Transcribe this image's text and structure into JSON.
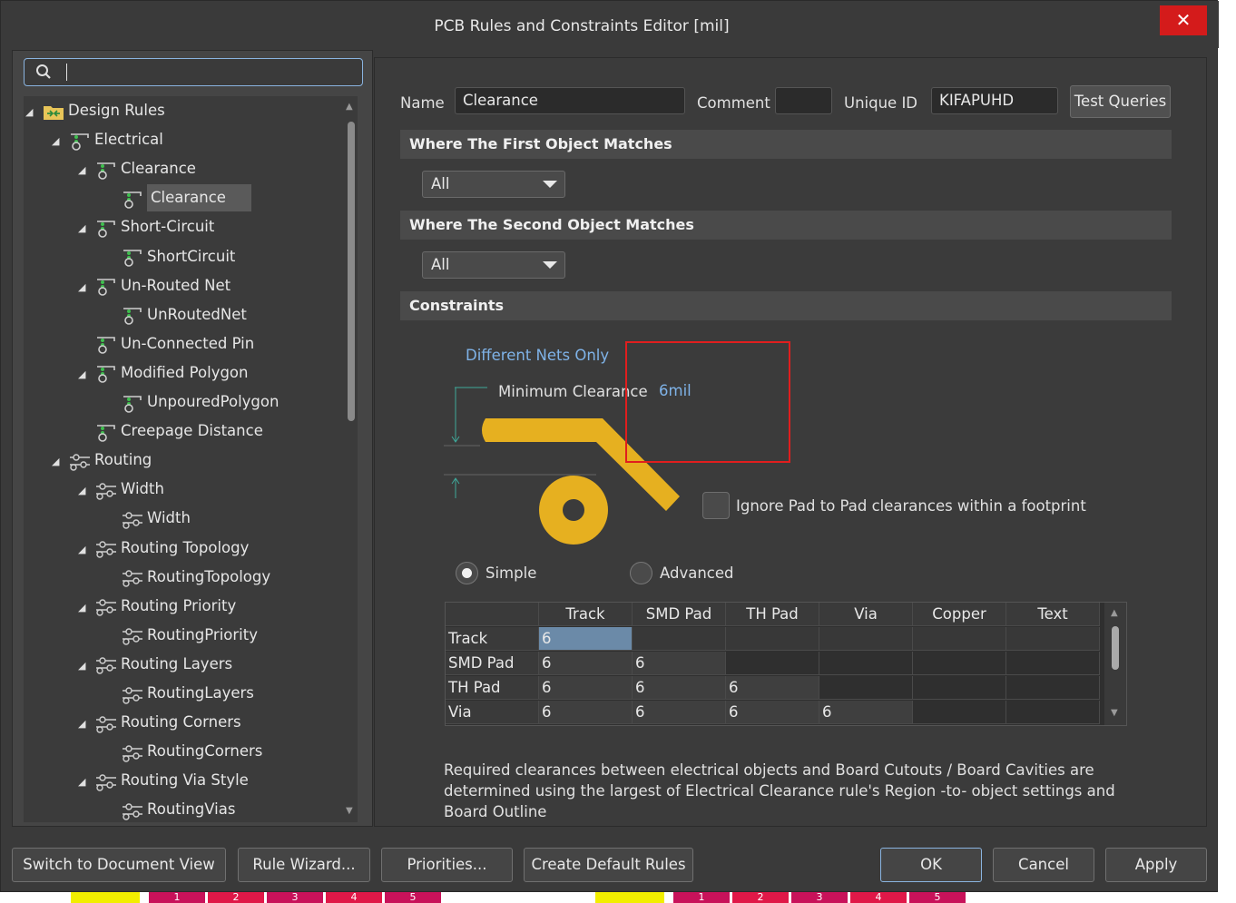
{
  "window": {
    "title": "PCB Rules and Constraints Editor [mil]",
    "close_glyph": "✕"
  },
  "search": {
    "value": "",
    "placeholder": ""
  },
  "tree": [
    {
      "label": "Design Rules",
      "level": 0,
      "expanded": true,
      "icon": "folder-rules-icon"
    },
    {
      "label": "Electrical",
      "level": 1,
      "expanded": true,
      "icon": "electrical-rule-icon"
    },
    {
      "label": "Clearance",
      "level": 2,
      "expanded": true,
      "icon": "electrical-rule-icon"
    },
    {
      "label": "Clearance",
      "level": 3,
      "selected": true,
      "icon": "electrical-rule-icon"
    },
    {
      "label": "Short-Circuit",
      "level": 2,
      "expanded": true,
      "icon": "electrical-rule-icon"
    },
    {
      "label": "ShortCircuit",
      "level": 3,
      "icon": "electrical-rule-icon"
    },
    {
      "label": "Un-Routed Net",
      "level": 2,
      "expanded": true,
      "icon": "electrical-rule-icon"
    },
    {
      "label": "UnRoutedNet",
      "level": 3,
      "icon": "electrical-rule-icon"
    },
    {
      "label": "Un-Connected Pin",
      "level": 2,
      "icon": "electrical-rule-icon"
    },
    {
      "label": "Modified Polygon",
      "level": 2,
      "expanded": true,
      "icon": "electrical-rule-icon"
    },
    {
      "label": "UnpouredPolygon",
      "level": 3,
      "icon": "electrical-rule-icon"
    },
    {
      "label": "Creepage Distance",
      "level": 2,
      "icon": "electrical-rule-icon"
    },
    {
      "label": "Routing",
      "level": 1,
      "expanded": true,
      "icon": "routing-rule-icon"
    },
    {
      "label": "Width",
      "level": 2,
      "expanded": true,
      "icon": "routing-rule-icon"
    },
    {
      "label": "Width",
      "level": 3,
      "icon": "routing-rule-icon"
    },
    {
      "label": "Routing Topology",
      "level": 2,
      "expanded": true,
      "icon": "routing-rule-icon"
    },
    {
      "label": "RoutingTopology",
      "level": 3,
      "icon": "routing-rule-icon"
    },
    {
      "label": "Routing Priority",
      "level": 2,
      "expanded": true,
      "icon": "routing-rule-icon"
    },
    {
      "label": "RoutingPriority",
      "level": 3,
      "icon": "routing-rule-icon"
    },
    {
      "label": "Routing Layers",
      "level": 2,
      "expanded": true,
      "icon": "routing-rule-icon"
    },
    {
      "label": "RoutingLayers",
      "level": 3,
      "icon": "routing-rule-icon"
    },
    {
      "label": "Routing Corners",
      "level": 2,
      "expanded": true,
      "icon": "routing-rule-icon"
    },
    {
      "label": "RoutingCorners",
      "level": 3,
      "icon": "routing-rule-icon"
    },
    {
      "label": "Routing Via Style",
      "level": 2,
      "expanded": true,
      "icon": "routing-rule-icon"
    },
    {
      "label": "RoutingVias",
      "level": 3,
      "icon": "routing-rule-icon"
    }
  ],
  "rule": {
    "name_label": "Name",
    "name_value": "Clearance",
    "comment_label": "Comment",
    "comment_value": "",
    "uid_label": "Unique ID",
    "uid_value": "KIFAPUHD",
    "test_queries": "Test Queries"
  },
  "first_match": {
    "header": "Where The First Object Matches",
    "selected": "All"
  },
  "second_match": {
    "header": "Where The Second Object Matches",
    "selected": "All"
  },
  "constraints": {
    "header": "Constraints",
    "net_scope": "Different Nets Only",
    "min_clearance_label": "Minimum Clearance",
    "min_clearance_value": "6mil",
    "ignore_pad_label": "Ignore Pad to Pad clearances within a footprint",
    "ignore_pad_checked": false,
    "mode_simple": "Simple",
    "mode_advanced": "Advanced",
    "mode_selected": "Simple",
    "pad_color": "#e6b020",
    "highlight_color": "#e01e1e"
  },
  "grid": {
    "columns": [
      "",
      "Track",
      "SMD Pad",
      "TH Pad",
      "Via",
      "Copper",
      "Text"
    ],
    "rows": [
      [
        "Track",
        "6",
        "",
        "",
        "",
        "",
        ""
      ],
      [
        "SMD Pad",
        "6",
        "6",
        "",
        "",
        "",
        ""
      ],
      [
        "TH Pad",
        "6",
        "6",
        "6",
        "",
        "",
        ""
      ],
      [
        "Via",
        "6",
        "6",
        "6",
        "6",
        "",
        ""
      ]
    ]
  },
  "footer_note": "Required clearances between electrical objects and Board Cutouts / Board Cavities are determined using the largest of Electrical Clearance rule's Region -to- object settings and Board Outline",
  "buttons": {
    "switch_view": "Switch to Document View",
    "rule_wizard": "Rule Wizard...",
    "priorities": "Priorities...",
    "create_default": "Create Default Rules",
    "ok": "OK",
    "cancel": "Cancel",
    "apply": "Apply"
  },
  "layer_tabs": [
    "1",
    "2",
    "3",
    "4",
    "5",
    "1",
    "2",
    "3",
    "4",
    "5"
  ]
}
